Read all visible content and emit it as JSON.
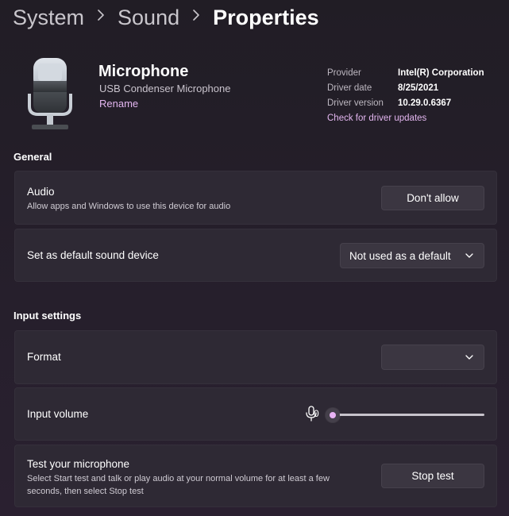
{
  "breadcrumb": {
    "items": [
      "System",
      "Sound"
    ],
    "current": "Properties"
  },
  "device": {
    "name": "Microphone",
    "subtitle": "USB Condenser Microphone",
    "rename_label": "Rename",
    "icon": "microphone-icon"
  },
  "driver": {
    "provider_label": "Provider",
    "provider_value": "Intel(R) Corporation",
    "date_label": "Driver date",
    "date_value": "8/25/2021",
    "version_label": "Driver version",
    "version_value": "10.29.0.6367",
    "update_link": "Check for driver updates"
  },
  "general": {
    "title": "General",
    "audio": {
      "title": "Audio",
      "description": "Allow apps and Windows to use this device for audio",
      "button_label": "Don't allow"
    },
    "default_device": {
      "title": "Set as default sound device",
      "selected": "Not used as a default"
    }
  },
  "input_settings": {
    "title": "Input settings",
    "format": {
      "title": "Format",
      "selected": ""
    },
    "volume": {
      "title": "Input volume",
      "value": "0",
      "level_percent": 0
    },
    "test": {
      "title": "Test your microphone",
      "description": "Select Start test and talk or play audio at your normal volume for at least a few seconds, then select Stop test",
      "button_label": "Stop test"
    }
  },
  "colors": {
    "accent": "#e3b6f0",
    "background": "#241f29",
    "card": "#2e2934",
    "button": "#3b3641"
  }
}
